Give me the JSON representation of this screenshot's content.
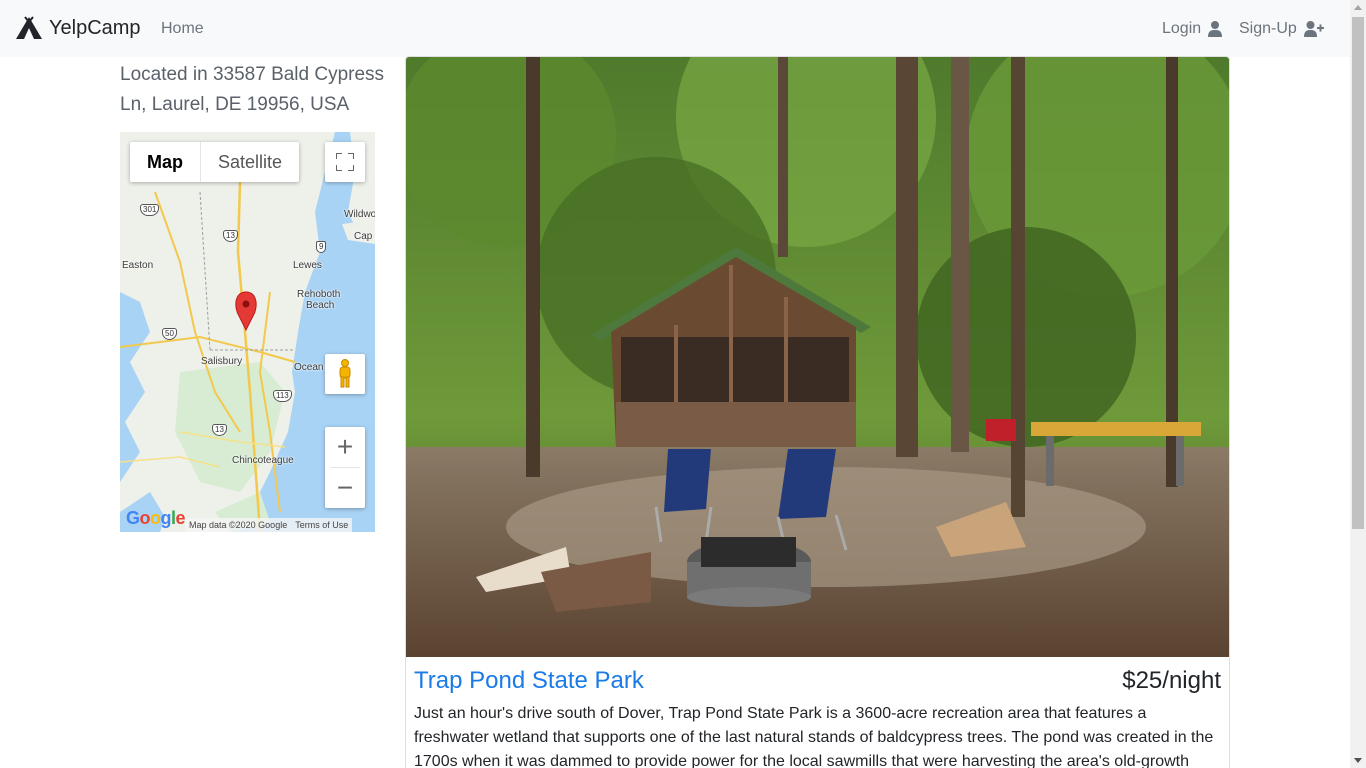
{
  "navbar": {
    "brand": "YelpCamp",
    "home": "Home",
    "login": "Login",
    "signup": "Sign-Up"
  },
  "location": {
    "text": "Located in 33587 Bald Cypress Ln, Laurel, DE 19956, USA"
  },
  "map": {
    "type_map": "Map",
    "type_satellite": "Satellite",
    "zoom_in": "+",
    "zoom_out": "−",
    "places": {
      "easton": "Easton",
      "lewes": "Lewes",
      "rehoboth": "Rehoboth",
      "rehoboth2": "Beach",
      "salisbury": "Salisbury",
      "ocean": "Ocean",
      "chincoteague": "Chincoteague",
      "wildwood": "Wildwo",
      "cape": "Cap"
    },
    "shields": {
      "r301": "301",
      "r13a": "13",
      "r9": "9",
      "r50": "50",
      "r113": "113",
      "r13b": "13"
    },
    "google": "Google",
    "map_data": "Map data ©2020 Google",
    "terms": "Terms of Use"
  },
  "campground": {
    "title": "Trap Pond State Park",
    "price": "$25/night",
    "description": "Just an hour's drive south of Dover, Trap Pond State Park is a 3600-acre recreation area that features a freshwater wetland that supports one of the last natural stands of baldcypress trees. The pond was created in the 1700s when it was dammed to provide power for the local sawmills that were harvesting the area's old-growth timber. Once"
  },
  "colors": {
    "navbar_bg": "#f8f9fa",
    "link": "#1a7be6",
    "marker": "#e53935"
  }
}
